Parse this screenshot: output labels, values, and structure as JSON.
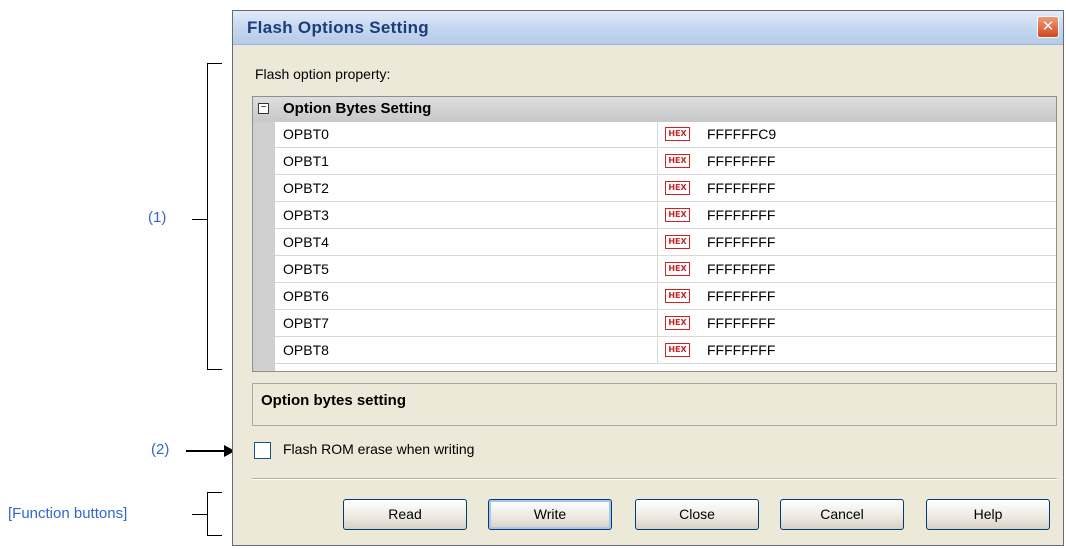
{
  "annotations": {
    "callout_1": "(1)",
    "callout_2": "(2)",
    "callout_buttons": "[Function buttons]"
  },
  "dialog": {
    "title": "Flash Options Setting",
    "close_glyph": "✕",
    "property_label": "Flash option property:",
    "category": {
      "toggle": "−",
      "label": "Option Bytes Setting"
    },
    "hex_badge": "HEX",
    "rows": [
      {
        "name": "OPBT0",
        "value": "FFFFFFC9"
      },
      {
        "name": "OPBT1",
        "value": "FFFFFFFF"
      },
      {
        "name": "OPBT2",
        "value": "FFFFFFFF"
      },
      {
        "name": "OPBT3",
        "value": "FFFFFFFF"
      },
      {
        "name": "OPBT4",
        "value": "FFFFFFFF"
      },
      {
        "name": "OPBT5",
        "value": "FFFFFFFF"
      },
      {
        "name": "OPBT6",
        "value": "FFFFFFFF"
      },
      {
        "name": "OPBT7",
        "value": "FFFFFFFF"
      },
      {
        "name": "OPBT8",
        "value": "FFFFFFFF"
      }
    ],
    "description": "Option bytes setting",
    "erase_checkbox": {
      "label": "Flash ROM erase when writing",
      "checked": false
    },
    "buttons": {
      "read": "Read",
      "write": "Write",
      "close": "Close",
      "cancel": "Cancel",
      "help": "Help"
    }
  },
  "colors": {
    "callout_text": "#3366cc",
    "dialog_bg": "#ece9d8",
    "title_text": "#1d3c78",
    "hex_badge": "#cc2222"
  }
}
